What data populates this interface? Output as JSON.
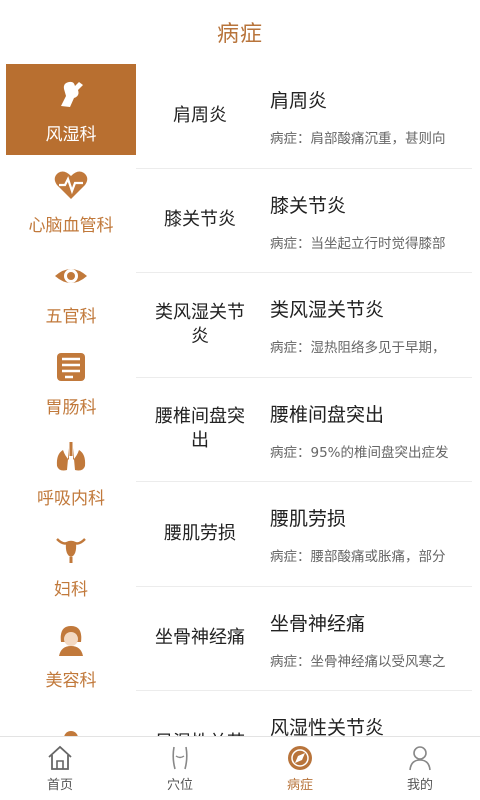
{
  "header": {
    "title": "病症"
  },
  "colors": {
    "accent": "#b86f30",
    "text": "#222222",
    "muted": "#666666"
  },
  "sidebar": {
    "items": [
      {
        "label": "风湿科",
        "icon": "joint-icon",
        "active": true
      },
      {
        "label": "心脑血管科",
        "icon": "heart-pulse-icon",
        "active": false
      },
      {
        "label": "五官科",
        "icon": "eye-icon",
        "active": false
      },
      {
        "label": "胃肠科",
        "icon": "intestine-icon",
        "active": false
      },
      {
        "label": "呼吸内科",
        "icon": "lungs-icon",
        "active": false
      },
      {
        "label": "妇科",
        "icon": "uterus-icon",
        "active": false
      },
      {
        "label": "美容科",
        "icon": "woman-face-icon",
        "active": false
      },
      {
        "label": "",
        "icon": "person-icon",
        "active": false
      }
    ]
  },
  "diseases": [
    {
      "name": "肩周炎",
      "title": "肩周炎",
      "desc": "病症：肩部酸痛沉重，甚则向"
    },
    {
      "name": "膝关节炎",
      "title": "膝关节炎",
      "desc": "病症：当坐起立行时觉得膝部"
    },
    {
      "name": "类风湿关节炎",
      "title": "类风湿关节炎",
      "desc": "病症：湿热阻络多见于早期，"
    },
    {
      "name": "腰椎间盘突出",
      "title": "腰椎间盘突出",
      "desc": "病症：95%的椎间盘突出症发"
    },
    {
      "name": "腰肌劳损",
      "title": "腰肌劳损",
      "desc": "病症：腰部酸痛或胀痛，部分"
    },
    {
      "name": "坐骨神经痛",
      "title": "坐骨神经痛",
      "desc": "病症：坐骨神经痛以受风寒之"
    },
    {
      "name": "风湿性关节",
      "title": "风湿性关节炎",
      "desc": ""
    }
  ],
  "tabbar": {
    "items": [
      {
        "label": "首页",
        "icon": "home-icon",
        "active": false
      },
      {
        "label": "穴位",
        "icon": "body-icon",
        "active": false
      },
      {
        "label": "病症",
        "icon": "compass-icon",
        "active": true
      },
      {
        "label": "我的",
        "icon": "user-icon",
        "active": false
      }
    ]
  }
}
